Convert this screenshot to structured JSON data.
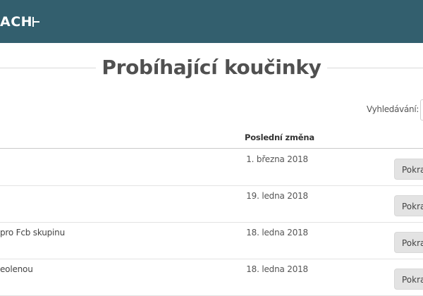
{
  "header": {
    "logo_text": "ACH"
  },
  "page": {
    "title": "Probíhající koučinky"
  },
  "search": {
    "label": "Vyhledávání:",
    "value": ""
  },
  "table": {
    "columns": {
      "name": "",
      "last_change": "Poslední změna"
    },
    "rows": [
      {
        "name": "",
        "last_change": "1. března 2018",
        "action": "Pokra"
      },
      {
        "name": "",
        "last_change": "19. ledna 2018",
        "action": "Pokra"
      },
      {
        "name": "pro Fcb skupinu",
        "last_change": "18. ledna 2018",
        "action": "Pokra"
      },
      {
        "name": "eolenou",
        "last_change": "18. ledna 2018",
        "action": "Pokra"
      }
    ]
  },
  "colors": {
    "header_bg": "#335f6e",
    "button_bg": "#e3e3e3"
  }
}
